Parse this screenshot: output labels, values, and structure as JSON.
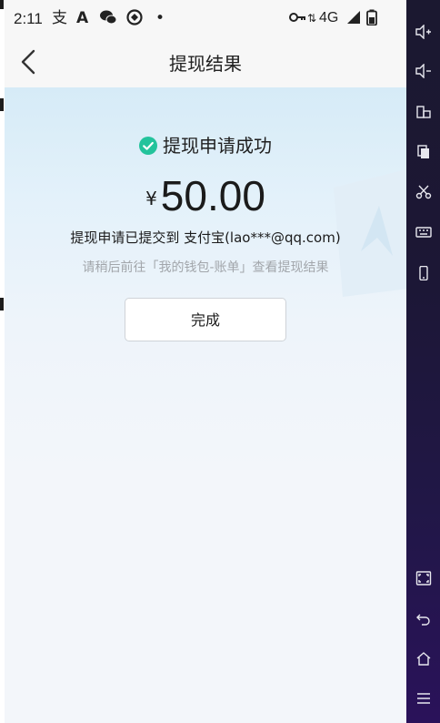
{
  "status_bar": {
    "time": "2:11",
    "icons": [
      "alipay-icon",
      "warning-a-icon",
      "wechat-icon",
      "sync-icon",
      "dot-icon"
    ],
    "right_icons": [
      "key-icon",
      "data-arrows-icon",
      "signal-icon",
      "battery-icon"
    ],
    "network": "4G"
  },
  "nav": {
    "title": "提现结果"
  },
  "result": {
    "status_text": "提现申请成功",
    "currency": "¥",
    "amount": "50.00",
    "submitted_text": "提现申请已提交到 支付宝(lao***@qq.com)",
    "hint_text": "请稍后前往「我的钱包-账单」查看提现结果",
    "done_label": "完成"
  },
  "colors": {
    "success_green": "#23c39c",
    "hint_gray": "#a2a6ab"
  },
  "side_controls": [
    "volume-up-icon",
    "volume-down-icon",
    "rotate-icon",
    "copy-icon",
    "cut-icon",
    "keyboard-icon",
    "phone-icon",
    "fullscreen-icon",
    "back-icon",
    "home-icon",
    "menu-icon"
  ]
}
